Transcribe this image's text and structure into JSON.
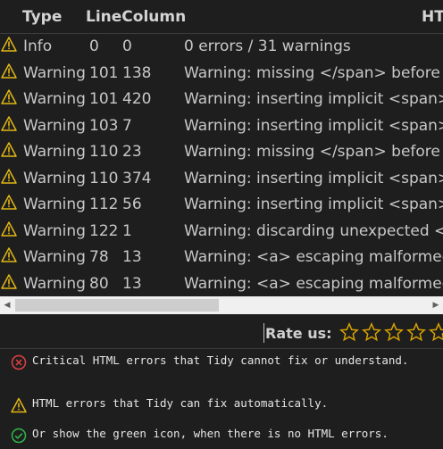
{
  "columns": {
    "type": "Type",
    "line_column": "LineColumn",
    "html": "HT"
  },
  "rows": [
    {
      "type": "Info",
      "line": "0",
      "column": "0",
      "message": "0 errors / 31 warnings"
    },
    {
      "type": "Warning",
      "line": "101",
      "column": "138",
      "message": "Warning: missing </span> before"
    },
    {
      "type": "Warning",
      "line": "101",
      "column": "420",
      "message": "Warning: inserting implicit <span>"
    },
    {
      "type": "Warning",
      "line": "103",
      "column": "7",
      "message": "Warning: inserting implicit <span>"
    },
    {
      "type": "Warning",
      "line": "110",
      "column": "23",
      "message": "Warning: missing </span> before"
    },
    {
      "type": "Warning",
      "line": "110",
      "column": "374",
      "message": "Warning: inserting implicit <span>"
    },
    {
      "type": "Warning",
      "line": "112",
      "column": "56",
      "message": "Warning: inserting implicit <span>"
    },
    {
      "type": "Warning",
      "line": "122",
      "column": "1",
      "message": "Warning: discarding unexpected </"
    },
    {
      "type": "Warning",
      "line": "78",
      "column": "13",
      "message": "Warning: <a> escaping malformed"
    },
    {
      "type": "Warning",
      "line": "80",
      "column": "13",
      "message": "Warning: <a> escaping malformed"
    }
  ],
  "rating": {
    "label": "Rate us:"
  },
  "legend": {
    "critical": "Critical HTML errors that Tidy cannot fix or understand.",
    "fixable": "HTML errors that Tidy can fix automatically.",
    "ok": "Or show the green icon, when there is no HTML errors."
  },
  "colors": {
    "warning": "#e2b714",
    "error": "#e04040",
    "ok": "#2fb84a",
    "star": "#d9a300"
  }
}
